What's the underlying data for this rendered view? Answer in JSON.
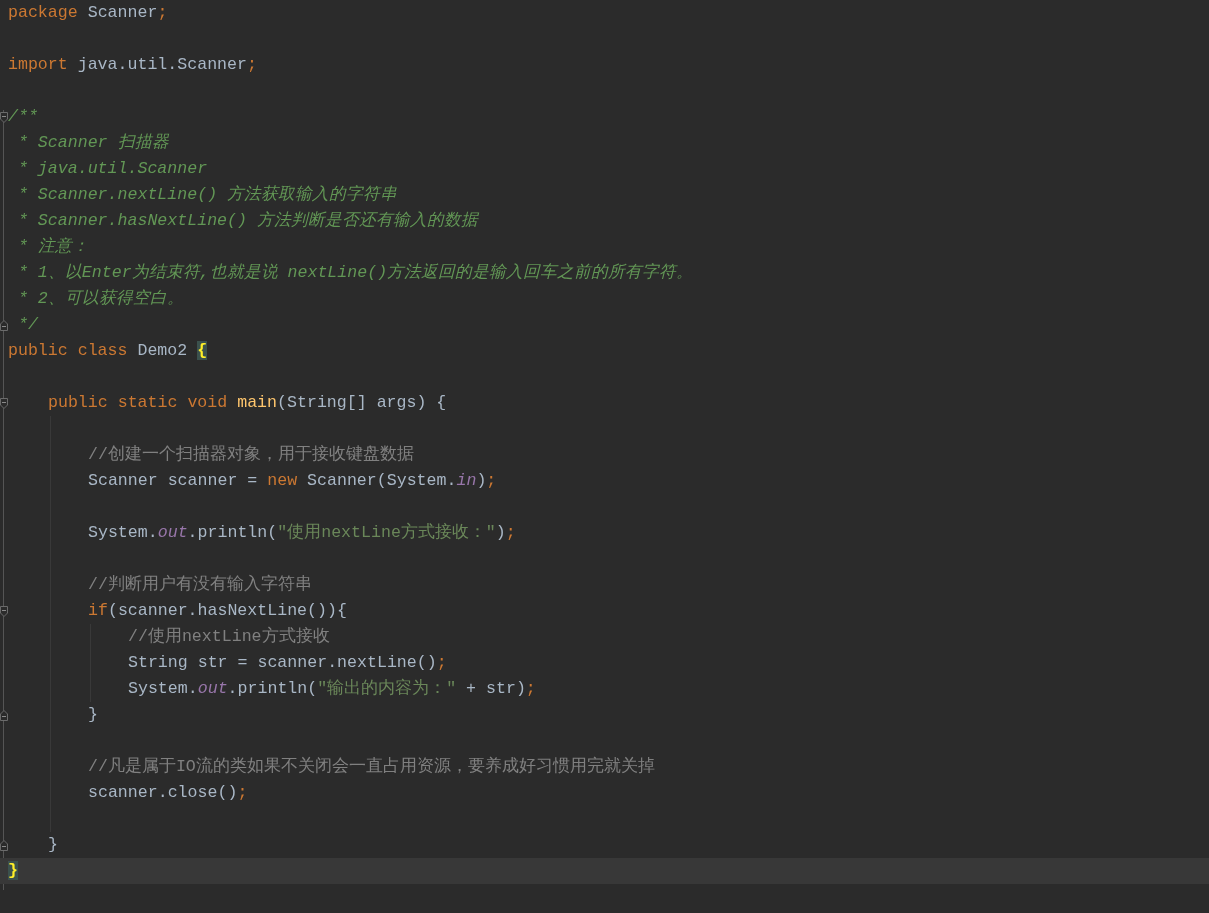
{
  "editor": {
    "lines": [
      {
        "current": false,
        "kind": "code",
        "tokens": [
          {
            "kind": "keyword",
            "text": "package"
          },
          {
            "kind": "plain",
            "text": " Scanner"
          },
          {
            "kind": "keyword",
            "text": ";"
          }
        ]
      },
      {
        "current": false
      },
      {
        "current": false,
        "kind": "code",
        "tokens": [
          {
            "kind": "keyword",
            "text": "import"
          },
          {
            "kind": "plain",
            "text": " java.util.Scanner"
          },
          {
            "kind": "keyword",
            "text": ";"
          }
        ]
      },
      {
        "current": false
      },
      {
        "current": false,
        "kind": "fold-start",
        "tokens": [
          {
            "kind": "doc",
            "text": "/**"
          }
        ]
      },
      {
        "current": false,
        "kind": "code",
        "tokens": [
          {
            "kind": "doc",
            "text": " * Scanner 扫描器"
          }
        ]
      },
      {
        "current": false,
        "kind": "code",
        "tokens": [
          {
            "kind": "doc",
            "text": " * java.util.Scanner"
          }
        ]
      },
      {
        "current": false,
        "kind": "code",
        "tokens": [
          {
            "kind": "doc",
            "text": " * Scanner.nextLine() 方法获取输入的字符串"
          }
        ]
      },
      {
        "current": false,
        "kind": "code",
        "tokens": [
          {
            "kind": "doc",
            "text": " * Scanner.hasNextLine() 方法判断是否还有输入的数据"
          }
        ]
      },
      {
        "current": false,
        "kind": "code",
        "tokens": [
          {
            "kind": "doc",
            "text": " * 注意："
          }
        ]
      },
      {
        "current": false,
        "kind": "code",
        "tokens": [
          {
            "kind": "doc",
            "text": " * 1、以Enter为结束符,也就是说 nextLine()方法返回的是输入回车之前的所有字符。"
          }
        ]
      },
      {
        "current": false,
        "kind": "code",
        "tokens": [
          {
            "kind": "doc",
            "text": " * 2、可以获得空白。"
          }
        ]
      },
      {
        "current": false,
        "kind": "fold-end",
        "tokens": [
          {
            "kind": "doc",
            "text": " */"
          }
        ]
      },
      {
        "current": false,
        "kind": "code",
        "tokens": [
          {
            "kind": "keyword",
            "text": "public class"
          },
          {
            "kind": "plain",
            "text": " Demo2 "
          },
          {
            "kind": "brace",
            "text": "{"
          }
        ],
        "children": [
          {
            "current": false
          },
          {
            "current": false,
            "kind": "fold-start",
            "tokens": [
              {
                "kind": "keyword",
                "text": "public static void "
              },
              {
                "kind": "method",
                "text": "main"
              },
              {
                "kind": "plain",
                "text": "(String[] args) {"
              }
            ],
            "children": [
              {
                "current": false
              },
              {
                "current": false,
                "kind": "code",
                "tokens": [
                  {
                    "kind": "comment",
                    "text": "//创建一个扫描器对象，用于接收键盘数据"
                  }
                ]
              },
              {
                "current": false,
                "kind": "code",
                "tokens": [
                  {
                    "kind": "plain",
                    "text": "Scanner scanner = "
                  },
                  {
                    "kind": "keyword",
                    "text": "new"
                  },
                  {
                    "kind": "plain",
                    "text": " Scanner(System."
                  },
                  {
                    "kind": "field",
                    "text": "in"
                  },
                  {
                    "kind": "plain",
                    "text": ")"
                  },
                  {
                    "kind": "keyword",
                    "text": ";"
                  }
                ]
              },
              {
                "current": false
              },
              {
                "current": false,
                "kind": "code",
                "tokens": [
                  {
                    "kind": "plain",
                    "text": "System."
                  },
                  {
                    "kind": "field",
                    "text": "out"
                  },
                  {
                    "kind": "plain",
                    "text": ".println("
                  },
                  {
                    "kind": "string",
                    "text": "\"使用nextLine方式接收：\""
                  },
                  {
                    "kind": "plain",
                    "text": ")"
                  },
                  {
                    "kind": "keyword",
                    "text": ";"
                  }
                ]
              },
              {
                "current": false
              },
              {
                "current": false,
                "kind": "code",
                "tokens": [
                  {
                    "kind": "comment",
                    "text": "//判断用户有没有输入字符串"
                  }
                ]
              },
              {
                "current": false,
                "kind": "fold-start",
                "tokens": [
                  {
                    "kind": "keyword",
                    "text": "if"
                  },
                  {
                    "kind": "plain",
                    "text": "(scanner.hasNextLine()){"
                  }
                ],
                "children": [
                  {
                    "current": false,
                    "kind": "code",
                    "tokens": [
                      {
                        "kind": "comment",
                        "text": "//使用nextLine方式接收"
                      }
                    ]
                  },
                  {
                    "current": false,
                    "kind": "code",
                    "tokens": [
                      {
                        "kind": "plain",
                        "text": "String str = scanner.nextLine()"
                      },
                      {
                        "kind": "keyword",
                        "text": ";"
                      }
                    ]
                  },
                  {
                    "current": false,
                    "kind": "code",
                    "tokens": [
                      {
                        "kind": "plain",
                        "text": "System."
                      },
                      {
                        "kind": "field",
                        "text": "out"
                      },
                      {
                        "kind": "plain",
                        "text": ".println("
                      },
                      {
                        "kind": "string",
                        "text": "\"输出的内容为：\""
                      },
                      {
                        "kind": "plain",
                        "text": " + str)"
                      },
                      {
                        "kind": "keyword",
                        "text": ";"
                      }
                    ]
                  }
                ]
              },
              {
                "current": false,
                "kind": "fold-end",
                "tokens": [
                  {
                    "kind": "plain",
                    "text": "}"
                  }
                ]
              },
              {
                "current": false
              },
              {
                "current": false,
                "kind": "code",
                "tokens": [
                  {
                    "kind": "comment",
                    "text": "//凡是属于IO流的类如果不关闭会一直占用资源，要养成好习惯用完就关掉"
                  }
                ]
              },
              {
                "current": false,
                "kind": "code",
                "tokens": [
                  {
                    "kind": "plain",
                    "text": "scanner.close()"
                  },
                  {
                    "kind": "keyword",
                    "text": ";"
                  }
                ]
              },
              {
                "current": false
              }
            ]
          },
          {
            "current": false,
            "kind": "fold-end",
            "tokens": [
              {
                "kind": "plain",
                "text": "}"
              }
            ]
          }
        ]
      },
      {
        "current": true,
        "kind": "code",
        "tokens": [
          {
            "kind": "brace",
            "text": "}"
          }
        ]
      }
    ]
  }
}
